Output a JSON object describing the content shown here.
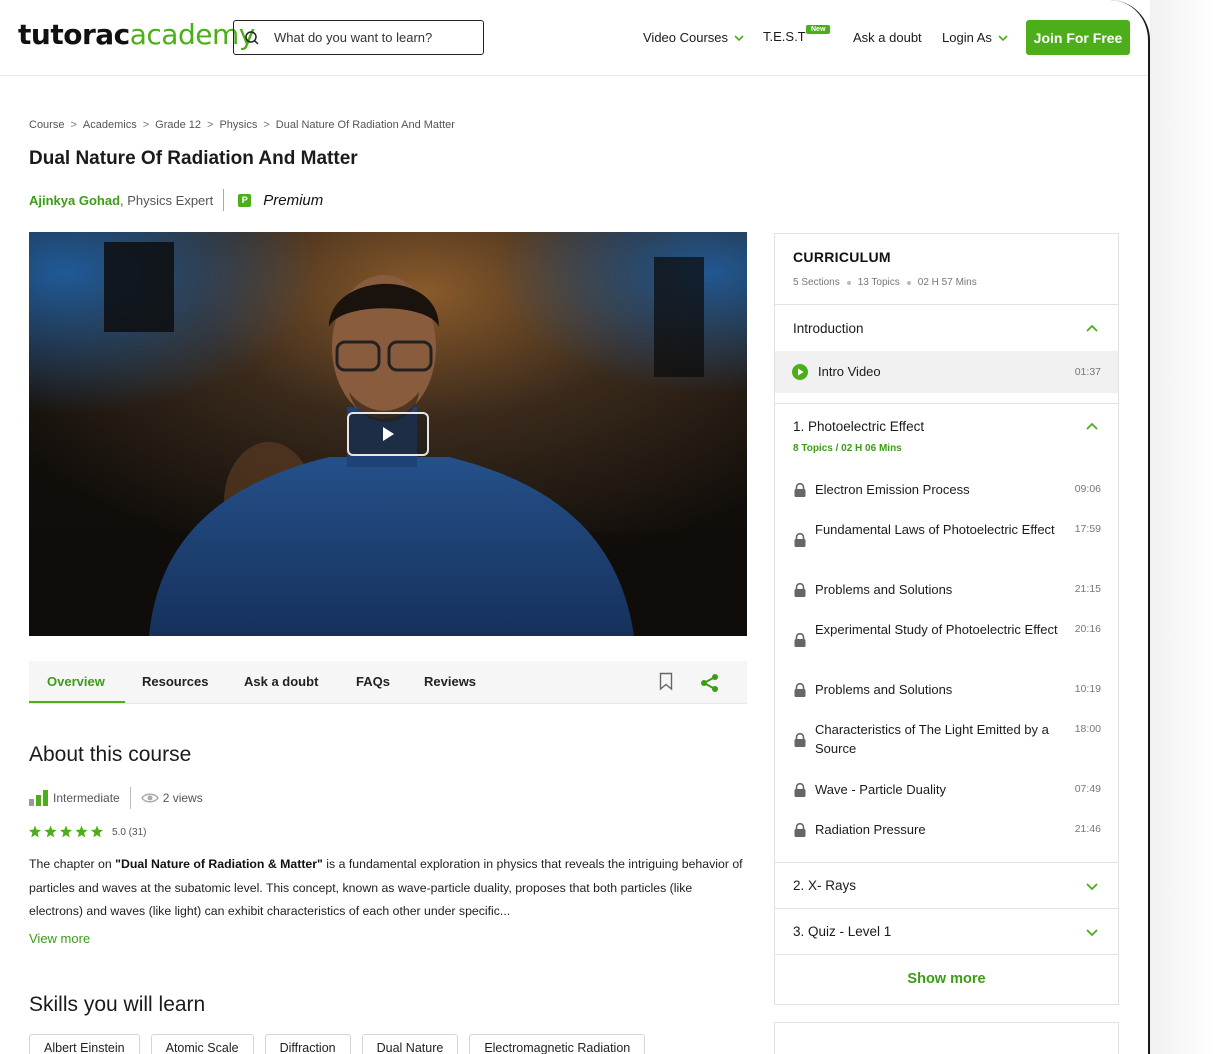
{
  "header": {
    "logo_part1": "tutorac",
    "logo_part2": "academy",
    "search_placeholder": "What do you want to learn?",
    "nav_video_courses": "Video Courses",
    "nav_test": "T.E.S.T",
    "nav_test_badge": "New",
    "nav_ask_doubt": "Ask a doubt",
    "nav_login_as": "Login As",
    "join_button": "Join For Free"
  },
  "breadcrumb": [
    "Course",
    "Academics",
    "Grade 12",
    "Physics",
    "Dual Nature Of Radiation And Matter"
  ],
  "course": {
    "title": "Dual Nature Of Radiation And Matter",
    "author_name": "Ajinkya Gohad",
    "author_role": ", Physics Expert",
    "premium_badge": "P",
    "premium_label": "Premium"
  },
  "tabs": [
    "Overview",
    "Resources",
    "Ask a doubt",
    "FAQs",
    "Reviews"
  ],
  "about": {
    "heading": "About this course",
    "level": "Intermediate",
    "views": "2 views",
    "rating_text": "5.0 (31)",
    "rating_value": 5,
    "desc_intro": "The chapter on ",
    "desc_bold": "\"Dual Nature of Radiation & Matter\"",
    "desc_rest": " is a fundamental exploration in physics that reveals the intriguing behavior of particles and waves at the subatomic level. This concept, known as wave-particle duality, proposes that both particles (like electrons) and waves (like light) can exhibit characteristics of each other under specific...",
    "view_more": "View more"
  },
  "skills": {
    "heading": "Skills you will learn",
    "items": [
      "Albert Einstein",
      "Atomic Scale",
      "Diffraction",
      "Dual Nature",
      "Electromagnetic Radiation"
    ]
  },
  "curriculum": {
    "title": "CURRICULUM",
    "sections_count": "5 Sections",
    "topics_count": "13 Topics",
    "duration": "02 H 57 Mins",
    "intro_section": "Introduction",
    "intro_video": "Intro Video",
    "intro_time": "01:37",
    "section1": "1. Photoelectric Effect",
    "section1_sub": "8 Topics / 02 H 06 Mins",
    "topics": [
      {
        "label": "Electron Emission Process",
        "time": "09:06"
      },
      {
        "label": "Fundamental Laws of Photoelectric Effect",
        "time": "17:59"
      },
      {
        "label": "Problems and Solutions",
        "time": "21:15"
      },
      {
        "label": "Experimental Study of Photoelectric Effect",
        "time": "20:16"
      },
      {
        "label": "Problems and Solutions",
        "time": "10:19"
      },
      {
        "label": "Characteristics of The Light Emitted by a Source",
        "time": "18:00"
      },
      {
        "label": "Wave - Particle Duality",
        "time": "07:49"
      },
      {
        "label": "Radiation Pressure",
        "time": "21:46"
      }
    ],
    "section2": "2. X- Rays",
    "section3": "3. Quiz - Level 1",
    "show_more": "Show more"
  },
  "colors": {
    "accent": "#4caf1a",
    "accent_text": "#3d9c17"
  }
}
